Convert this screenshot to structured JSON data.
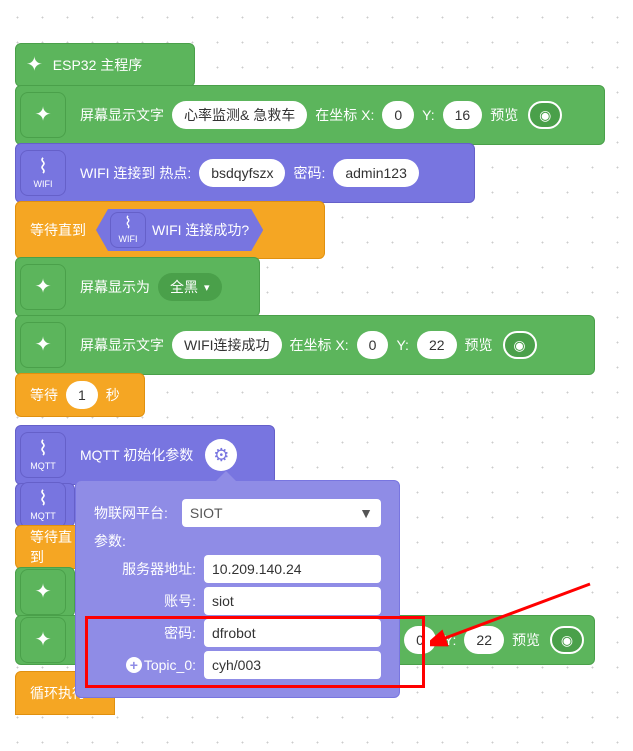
{
  "blocks": {
    "main_program": "ESP32 主程序",
    "display_text_label": "屏幕显示文字",
    "monitor_text": "心率监测& 急救车",
    "coord_x_label": "在坐标 X:",
    "coord_y_label": "Y:",
    "x1": "0",
    "y1": "16",
    "preview": "预览",
    "wifi_connect_label": "WIFI 连接到 热点:",
    "wifi_ssid": "bsdqyfszx",
    "wifi_pwd_label": "密码:",
    "wifi_pwd": "admin123",
    "wait_until": "等待直到",
    "wifi_connected_q": "WIFI 连接成功?",
    "display_as": "屏幕显示为",
    "all_black": "全黑",
    "wifi_ok_text": "WIFI连接成功",
    "x2": "0",
    "y2": "22",
    "wait": "等待",
    "wait_val": "1",
    "sec": "秒",
    "mqtt_init": "MQTT 初始化参数",
    "x3": "0",
    "y3": "22",
    "wifi_nub": "WIFI",
    "mqtt_nub": "MQTT",
    "loop": "循环执行"
  },
  "popup": {
    "platform_label": "物联网平台:",
    "platform_value": "SIOT",
    "params_label": "参数:",
    "server_label": "服务器地址:",
    "server_value": "10.209.140.24",
    "account_label": "账号:",
    "account_value": "siot",
    "password_label": "密码:",
    "password_value": "dfrobot",
    "topic_label": "Topic_0:",
    "topic_value": "cyh/003"
  }
}
